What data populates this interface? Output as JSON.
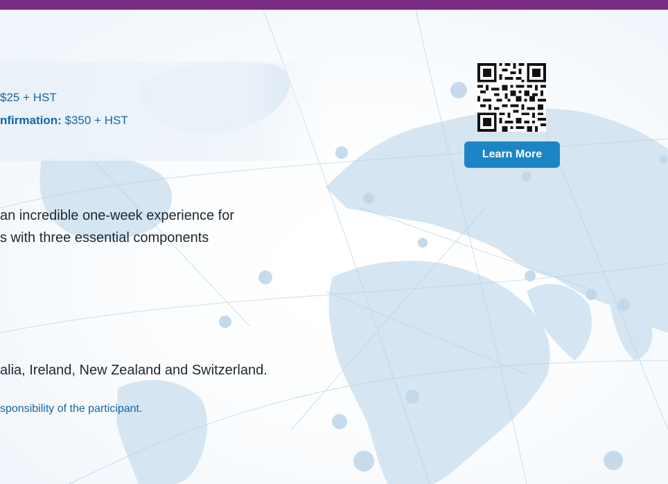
{
  "colors": {
    "top_bar": "#7a2c84",
    "accent_blue": "#1565a3",
    "button_blue": "#1a86c5",
    "body_text": "#1f2630",
    "map_land": "#c7dced"
  },
  "fees": {
    "line1_value": "$25 + HST",
    "line2_label": "nfirmation:",
    "line2_value": " $350 + HST"
  },
  "description": {
    "line1": "an incredible one-week experience for",
    "line2": "s with three essential components"
  },
  "countries_line": "alia, Ireland, New Zealand and Switzerland.",
  "note_line": "sponsibility of the participant.",
  "qr": {
    "icon": "qr-code-icon"
  },
  "learn_more_label": "Learn More"
}
